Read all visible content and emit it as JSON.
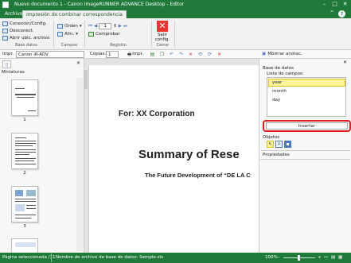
{
  "window": {
    "title": "Nuevo documento 1 - Canon imageRUNNER ADVANCE Desktop - Editor",
    "help_label": "?"
  },
  "ribbon_tabs": [
    {
      "label": "Archivo"
    },
    {
      "label": "Impresión de combinar correspondencia"
    }
  ],
  "ribbon": {
    "base_datos": {
      "conexion": "Conexión/Config.",
      "desconect": "Desconect.",
      "abrir": "Abrir ubic. archivo",
      "group": "Base datos"
    },
    "campos": {
      "orden": "Orden",
      "alin": "Alin.",
      "group": "Campos"
    },
    "registro": {
      "page_value": "1",
      "comprobar": "Comprobar",
      "group": "Registro"
    },
    "cerrar": {
      "label": "Salir config.",
      "group": "Cerrar"
    }
  },
  "toolbar2": {
    "printer_label": "Impr.",
    "printer_value": "Canon iR-ADV",
    "copias_label": "Copias:",
    "copias_value": "1",
    "impr_button": "Impr.",
    "mostrar": "Mostrar anotac."
  },
  "left_panel": {
    "tab_label": "Miniaturas",
    "pages": [
      "1",
      "2",
      "3"
    ]
  },
  "document": {
    "for_line": "For: XX Corporation",
    "heading": "Summary of Rese",
    "subheading": "The Future Development of “DE LA C"
  },
  "right_panel": {
    "section_db": "Base de datos",
    "fields_label": "Lista de campos:",
    "fields": [
      "year",
      "month",
      "day"
    ],
    "insert_button": "Insertar",
    "objetos_label": "Objetos",
    "propiedades_label": "Propiedades"
  },
  "status": {
    "page_selected": "Página seleccionada /11",
    "db_filename": "Nombre de archivo de base de datos: Sample.xls",
    "zoom": "100%"
  },
  "colors": {
    "accent": "#1f7a3a",
    "highlight": "#e02020",
    "field_selected": "#fff59a"
  }
}
